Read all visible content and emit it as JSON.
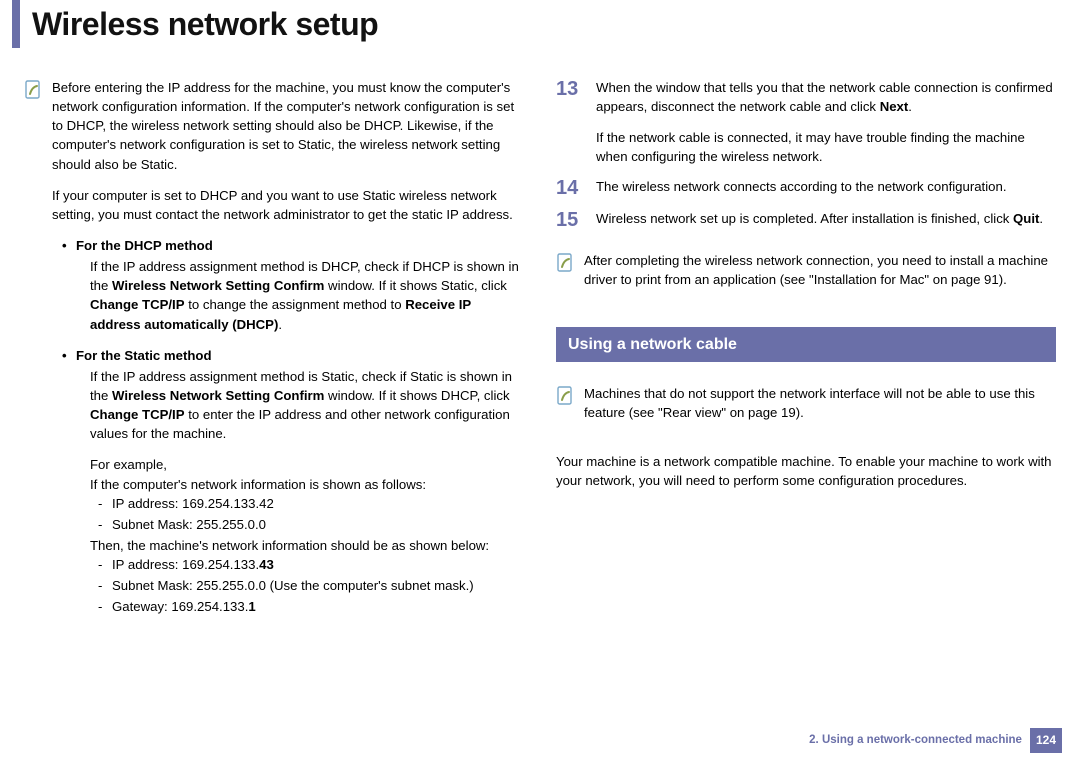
{
  "title": "Wireless network setup",
  "left": {
    "note1_p1": "Before entering the IP address for the machine, you must know the computer's network configuration information. If the computer's network configuration is set to DHCP, the wireless network setting should also be DHCP. Likewise, if the computer's network configuration is set to Static, the wireless network setting should also be Static.",
    "note1_p2": "If your computer is set to DHCP and you want to use Static wireless network setting, you must contact the network administrator to get the static IP address.",
    "dhcp_heading": "For the DHCP method",
    "dhcp_body_pre": "If the IP address assignment method is DHCP, check if DHCP is shown in the ",
    "dhcp_b1": "Wireless Network Setting Confirm",
    "dhcp_mid1": " window. If it shows Static, click ",
    "dhcp_b2": "Change TCP/IP",
    "dhcp_mid2": " to change the assignment method to ",
    "dhcp_b3": "Receive IP address automatically (DHCP)",
    "dhcp_end": ".",
    "static_heading": "For the Static method",
    "static_body_pre": "If the IP address assignment method is Static, check if Static is shown in the ",
    "static_b1": "Wireless Network Setting Confirm",
    "static_mid1": " window. If it shows DHCP, click ",
    "static_b2": "Change TCP/IP",
    "static_end": " to enter the IP address and other network configuration values for the machine.",
    "example_lead": "For example,",
    "example_comp": "If the computer's network information is shown as follows:",
    "comp_ip": "IP address: 169.254.133.42",
    "comp_mask": "Subnet Mask: 255.255.0.0",
    "example_machine": "Then, the machine's network information should be as shown below:",
    "mach_ip_pre": "IP address: 169.254.133.",
    "mach_ip_b": "43",
    "mach_mask": "Subnet Mask: 255.255.0.0 (Use the computer's subnet mask.)",
    "mach_gw_pre": "Gateway: 169.254.133.",
    "mach_gw_b": "1"
  },
  "right": {
    "s13_num": "13",
    "s13_p1_pre": "When the window that tells you that the network cable connection is confirmed appears, disconnect the network cable and click ",
    "s13_p1_b": "Next",
    "s13_p1_end": ".",
    "s13_p2": "If the network cable is connected, it may have trouble finding the machine when configuring the wireless network.",
    "s14_num": "14",
    "s14_p1": "The wireless network connects according to the network configuration.",
    "s15_num": "15",
    "s15_p1_pre": "Wireless network set up is completed. After installation is finished, click ",
    "s15_p1_b": "Quit",
    "s15_p1_end": ".",
    "note_after": "After completing the wireless network connection, you need to install a machine driver to print from an application (see \"Installation for Mac\" on page 91).",
    "section_cable": "Using a network cable",
    "note_cable": "Machines that do not support the network interface will not be able to use this feature (see \"Rear view\" on page 19).",
    "cable_body": "Your machine is a network compatible machine. To enable your machine to work with your network, you will need to perform some configuration procedures."
  },
  "footer": {
    "chapter": "2.  Using a network-connected machine",
    "page": "124"
  }
}
